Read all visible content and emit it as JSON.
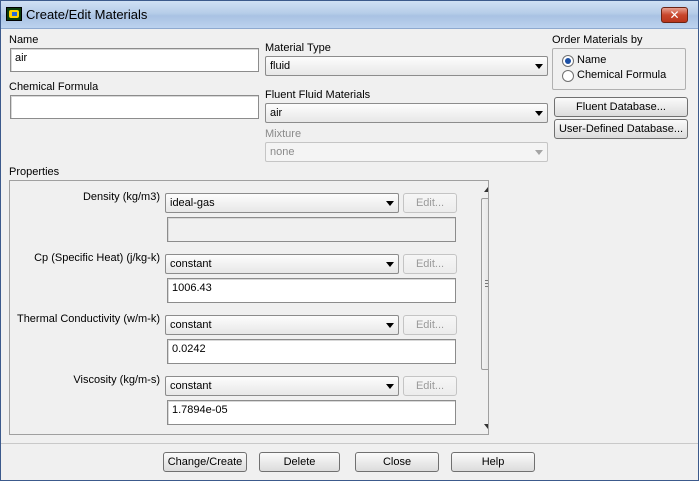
{
  "window": {
    "title": "Create/Edit Materials"
  },
  "name_field": {
    "label": "Name",
    "value": "air"
  },
  "chemical_formula": {
    "label": "Chemical Formula",
    "value": ""
  },
  "material_type": {
    "label": "Material Type",
    "value": "fluid"
  },
  "fluent_fluid_materials": {
    "label": "Fluent Fluid Materials",
    "value": "air"
  },
  "mixture": {
    "label": "Mixture",
    "value": "none"
  },
  "order_by": {
    "label": "Order Materials by",
    "options": [
      {
        "label": "Name",
        "checked": true
      },
      {
        "label": "Chemical Formula",
        "checked": false
      }
    ]
  },
  "database_buttons": {
    "fluent": "Fluent Database...",
    "user": "User-Defined Database..."
  },
  "properties": {
    "label": "Properties",
    "edit_label": "Edit...",
    "items": [
      {
        "label": "Density (kg/m3)",
        "method": "ideal-gas",
        "value": ""
      },
      {
        "label": "Cp (Specific Heat) (j/kg-k)",
        "method": "constant",
        "value": "1006.43"
      },
      {
        "label": "Thermal Conductivity (w/m-k)",
        "method": "constant",
        "value": "0.0242"
      },
      {
        "label": "Viscosity (kg/m-s)",
        "method": "constant",
        "value": "1.7894e-05"
      }
    ]
  },
  "actions": {
    "change_create": "Change/Create",
    "delete": "Delete",
    "close": "Close",
    "help": "Help"
  },
  "colors": {
    "title_bar": "#b6cde9",
    "close_button": "#c8462c",
    "window_bg": "#f0f0f0",
    "radio_dot": "#1b4fa5"
  }
}
